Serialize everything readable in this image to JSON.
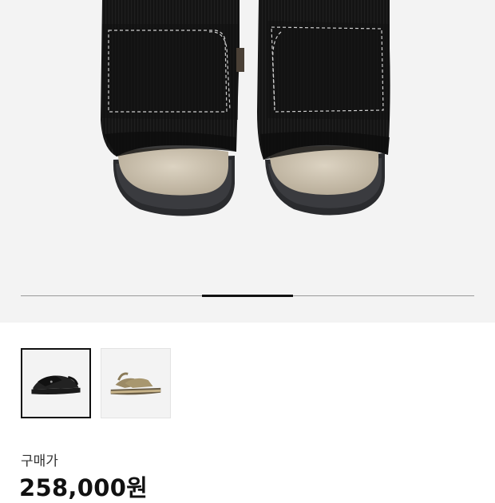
{
  "gallery": {
    "slide_fraction": 0.2,
    "slide_index_fraction_start": 0.4
  },
  "thumbnails": [
    {
      "color_name": "black",
      "selected": true
    },
    {
      "color_name": "beige",
      "selected": false
    }
  ],
  "price": {
    "label": "구매가",
    "value": "258,000원"
  },
  "colors": {
    "background": "#ffffff",
    "hero_background": "#f3f3f3",
    "text": "#111111",
    "progress_active": "#111111",
    "progress_track": "#9a9a9a"
  }
}
